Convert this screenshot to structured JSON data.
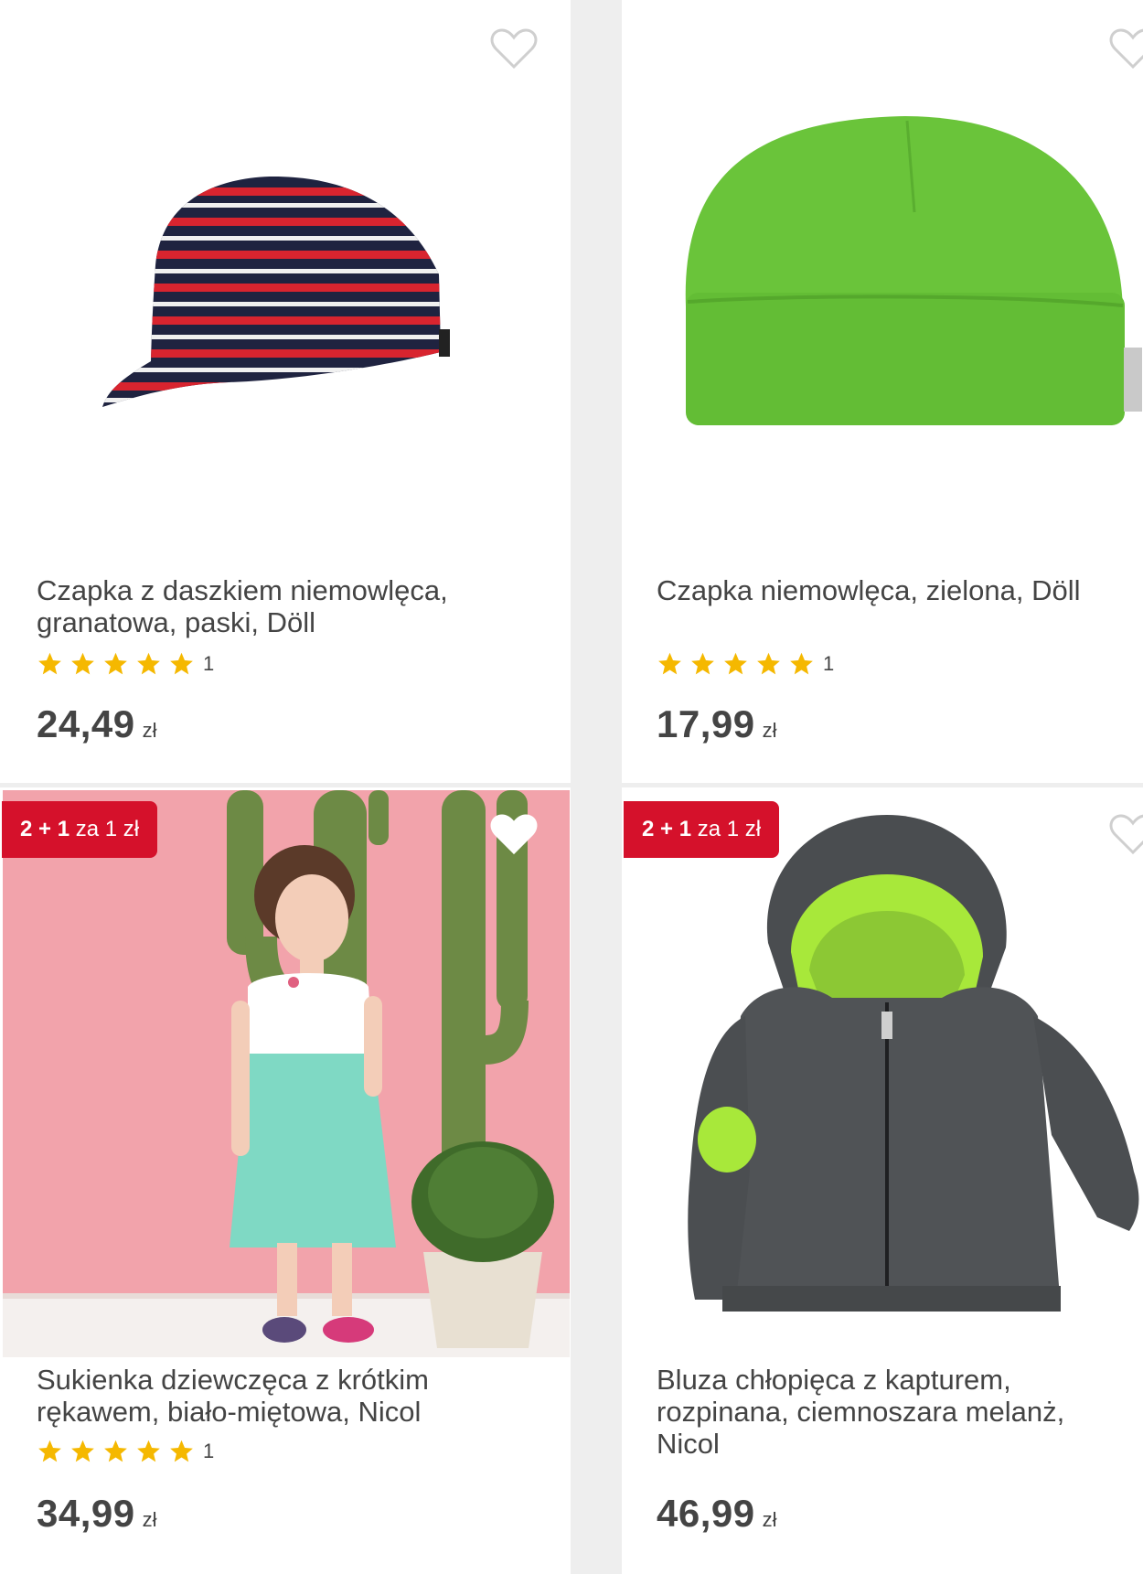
{
  "products": [
    {
      "title": "Czapka z daszkiem niemowlęca, granatowa, paski, Döll",
      "rating_count": "1",
      "stars": 5,
      "price": "24,49",
      "currency": "zł",
      "promo": null,
      "image": "striped-cap-image"
    },
    {
      "title": "Czapka niemowlęca, zielona, Döll",
      "rating_count": "1",
      "stars": 5,
      "price": "17,99",
      "currency": "zł",
      "promo": null,
      "image": "green-beanie-image"
    },
    {
      "title": "Sukienka dziewczęca z krótkim rękawem, biało-miętowa, Nicol",
      "rating_count": "1",
      "stars": 5,
      "price": "34,99",
      "currency": "zł",
      "promo": {
        "bold": "2 + 1",
        "light": "za 1 zł"
      },
      "image": "girl-dress-image"
    },
    {
      "title": "Bluza chłopięca z kapturem, rozpinana, ciemnoszara melanż, Nicol",
      "rating_count": null,
      "stars": 0,
      "price": "46,99",
      "currency": "zł",
      "promo": {
        "bold": "2 + 1",
        "light": "za 1 zł"
      },
      "image": "hoodie-image"
    }
  ],
  "colors": {
    "promo_badge": "#d5112b",
    "star": "#f5b800",
    "text": "#444444",
    "background": "#eeeeee"
  }
}
